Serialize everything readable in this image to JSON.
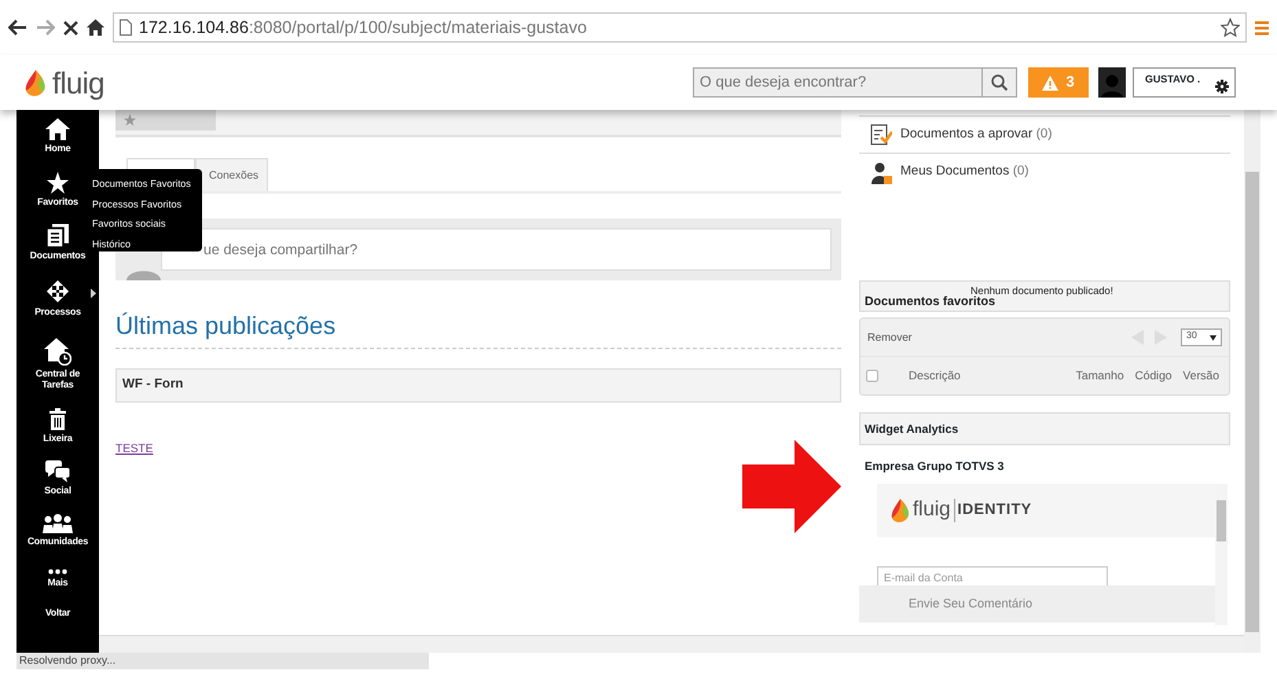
{
  "browser": {
    "url_host": "172.16.104.86",
    "url_path": ":8080/portal/p/100/subject/materiais-gustavo",
    "bookmarked": false
  },
  "header": {
    "logo": "fluig",
    "search": {
      "placeholder": "O que deseja encontrar?"
    },
    "alerts": "3",
    "user": "GUSTAVO ."
  },
  "sidebar": {
    "items": [
      {
        "label": "Home",
        "kind": "home",
        "submenu": false
      },
      {
        "label": "Favoritos",
        "kind": "star",
        "submenu": false
      },
      {
        "label": "Documentos",
        "kind": "documents",
        "submenu": false
      },
      {
        "label": "Processos",
        "kind": "processes",
        "submenu": true
      },
      {
        "label": "Central de Tarefas",
        "kind": "tasks",
        "submenu": false
      },
      {
        "label": "Lixeira",
        "kind": "trash",
        "submenu": false
      },
      {
        "label": "Social",
        "kind": "social",
        "submenu": false
      },
      {
        "label": "Comunidades",
        "kind": "communities",
        "submenu": false
      },
      {
        "label": "Mais",
        "kind": "more",
        "submenu": false
      },
      {
        "label": "Voltar",
        "kind": "none",
        "submenu": false
      }
    ]
  },
  "flyout": {
    "items": [
      "Documentos Favoritos",
      "Processos Favoritos",
      "Favoritos sociais",
      "Histórico"
    ]
  },
  "main": {
    "tabs": [
      {
        "selected": true
      },
      {
        "label": "Conexões",
        "selected": false
      }
    ],
    "share": {
      "placeholder": "ue deseja compartilhar?"
    },
    "heading": "Últimas publicações",
    "post_title": "WF - Forn",
    "link": "TESTE"
  },
  "right": {
    "links": [
      {
        "label": "Documentos a aprovar",
        "count": "(0)",
        "kind": "approve"
      },
      {
        "label": "Meus Documentos",
        "count": "(0)",
        "kind": "mine"
      }
    ],
    "favorites": {
      "title": "Documentos favoritos",
      "empty": "Nenhum documento publicado!",
      "action": "Remover",
      "page_size": "30",
      "select_all": false,
      "columns": [
        "Descrição",
        "Tamanho",
        "Código",
        "Versão"
      ]
    },
    "analytics": {
      "title": "Widget Analytics",
      "company": "Empresa Grupo TOTVS 3",
      "logo": "fluig",
      "logo_suffix": "IDENTITY",
      "email": {
        "placeholder": "E-mail da Conta"
      },
      "feedback": "Envie Seu Comentário"
    }
  },
  "status_bar": "Resolvendo proxy..."
}
